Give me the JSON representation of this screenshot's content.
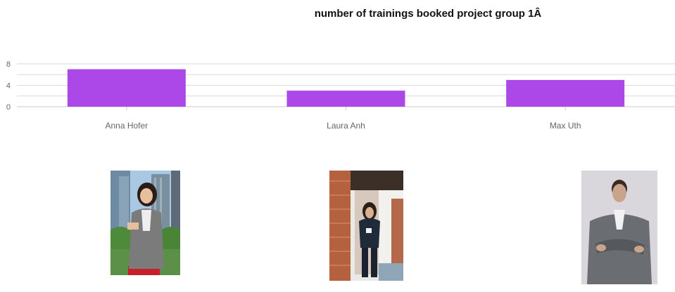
{
  "chart_data": {
    "type": "bar",
    "title": "number of trainings booked project group 1Â",
    "categories": [
      "Anna Hofer",
      "Laura Anh",
      "Max Uth"
    ],
    "values": [
      7,
      3,
      5
    ],
    "yticks": [
      0,
      4,
      8
    ],
    "ylim": [
      0,
      8
    ],
    "grid": true,
    "xlabel": "",
    "ylabel": "",
    "bar_color": "#ac48e8",
    "gridline_color": "#d9d9d9",
    "tick_label_color": "#666666"
  },
  "photos": [
    {
      "icon": "portrait-photo-anna-hofer"
    },
    {
      "icon": "portrait-photo-laura-anh"
    },
    {
      "icon": "portrait-photo-max-uth"
    }
  ]
}
